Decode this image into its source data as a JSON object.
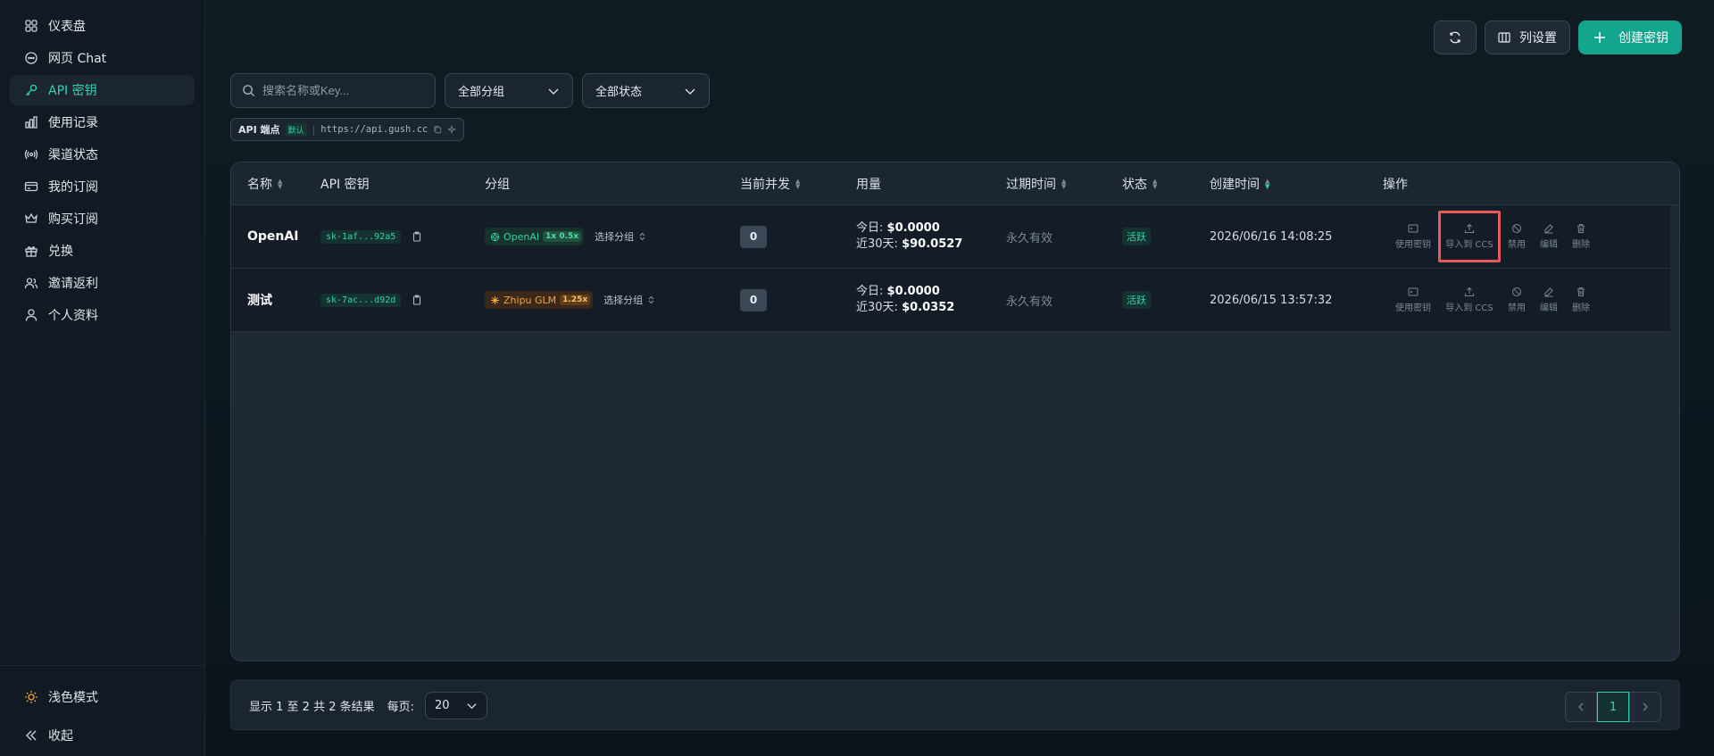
{
  "sidebar": {
    "items": [
      {
        "label": "仪表盘",
        "icon": "dashboard-icon",
        "active": false
      },
      {
        "label": "网页 Chat",
        "icon": "chat-icon",
        "active": false
      },
      {
        "label": "API 密钥",
        "icon": "key-icon",
        "active": true
      },
      {
        "label": "使用记录",
        "icon": "bar-chart-icon",
        "active": false
      },
      {
        "label": "渠道状态",
        "icon": "broadcast-icon",
        "active": false
      },
      {
        "label": "我的订阅",
        "icon": "credit-card-icon",
        "active": false
      },
      {
        "label": "购买订阅",
        "icon": "crown-icon",
        "active": false
      },
      {
        "label": "兑换",
        "icon": "gift-icon",
        "active": false
      },
      {
        "label": "邀请返利",
        "icon": "users-icon",
        "active": false
      },
      {
        "label": "个人资料",
        "icon": "user-icon",
        "active": false
      }
    ],
    "footer": {
      "theme_label": "浅色模式",
      "collapse_label": "收起"
    }
  },
  "toolbar": {
    "refresh_icon": "refresh-icon",
    "columns_label": "列设置",
    "create_label": "创建密钥"
  },
  "filters": {
    "search_placeholder": "搜索名称或Key...",
    "group_select": "全部分组",
    "status_select": "全部状态"
  },
  "endpoint": {
    "label": "API 端点",
    "default_tag": "默认",
    "url": "https://api.gush.cc"
  },
  "table": {
    "headers": {
      "name": "名称",
      "key": "API 密钥",
      "group": "分组",
      "concurrency": "当前并发",
      "usage": "用量",
      "expiry": "过期时间",
      "status": "状态",
      "created": "创建时间",
      "actions": "操作"
    },
    "rows": [
      {
        "name": "OpenAI",
        "key": "sk-1af...92a5",
        "group": "OpenAI",
        "multiplier": "1x 0.5x",
        "group_pick": "选择分组",
        "concurrency": "0",
        "today_label": "今日:",
        "today": "$0.0000",
        "month_label": "近30天:",
        "month": "$90.0527",
        "expiry": "永久有效",
        "status": "活跃",
        "created": "2026/06/16 14:08:25"
      },
      {
        "name": "测试",
        "key": "sk-7ac...d92d",
        "group": "Zhipu GLM",
        "multiplier": "1.25x",
        "group_pick": "选择分组",
        "concurrency": "0",
        "today_label": "今日:",
        "today": "$0.0000",
        "month_label": "近30天:",
        "month": "$0.0352",
        "expiry": "永久有效",
        "status": "活跃",
        "created": "2026/06/15 13:57:32"
      }
    ],
    "actions": {
      "use": "使用密钥",
      "import": "导入到 CCS",
      "disable": "禁用",
      "edit": "编辑",
      "delete": "删除"
    }
  },
  "pagination": {
    "summary": "显示 1 至 2 共 2 条结果",
    "per_page_label": "每页:",
    "per_page": "20",
    "current_page": "1"
  },
  "colors": {
    "accent": "#35d1b4",
    "primary_button": "#14a58e",
    "highlight_box": "#e85a5a"
  }
}
